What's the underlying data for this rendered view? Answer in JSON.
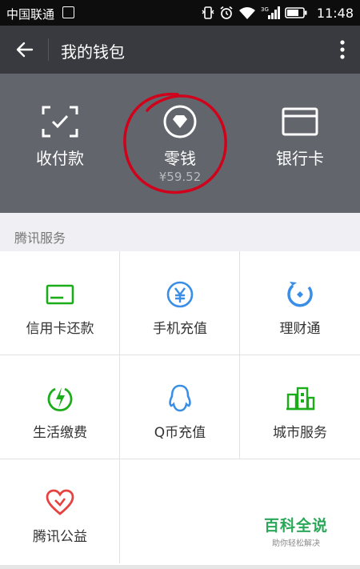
{
  "status_bar": {
    "carrier": "中国联通",
    "network": "3G",
    "time": "11:48"
  },
  "toolbar": {
    "title": "我的钱包"
  },
  "wallet": {
    "items": [
      {
        "label": "收付款",
        "icon": "qr-scan-icon"
      },
      {
        "label": "零钱",
        "sub": "¥59.52",
        "icon": "change-wallet-icon"
      },
      {
        "label": "银行卡",
        "icon": "bank-card-icon"
      }
    ]
  },
  "services": {
    "section_title": "腾讯服务",
    "items": [
      {
        "label": "信用卡还款",
        "icon": "credit-card-icon",
        "color": "#1aad19"
      },
      {
        "label": "手机充值",
        "icon": "yen-coin-icon",
        "color": "#3a8ee6"
      },
      {
        "label": "理财通",
        "icon": "wealth-icon",
        "color": "#3a8ee6"
      },
      {
        "label": "生活缴费",
        "icon": "lightning-icon",
        "color": "#1aad19"
      },
      {
        "label": "Q币充值",
        "icon": "penguin-icon",
        "color": "#3a8ee6"
      },
      {
        "label": "城市服务",
        "icon": "city-icon",
        "color": "#1aad19"
      },
      {
        "label": "腾讯公益",
        "icon": "heart-icon",
        "color": "#e64340"
      }
    ]
  },
  "watermark": {
    "title": "百科全说",
    "subtitle": "助你轻松解决"
  },
  "annotation_color": "#d0021b"
}
